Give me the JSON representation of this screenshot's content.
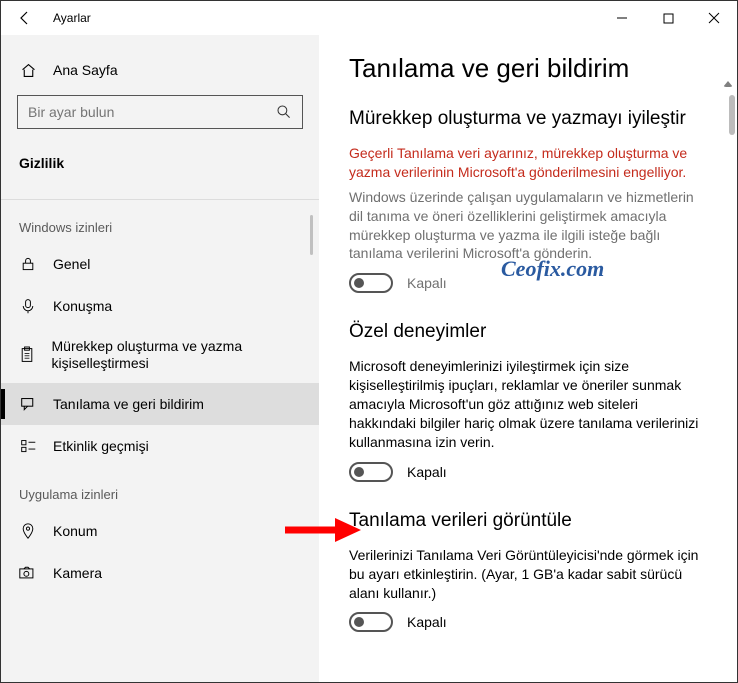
{
  "titlebar": {
    "app": "Ayarlar"
  },
  "sidebar": {
    "home": "Ana Sayfa",
    "search_placeholder": "Bir ayar bulun",
    "section": "Gizlilik",
    "group1": "Windows izinleri",
    "items1": [
      {
        "label": "Genel"
      },
      {
        "label": "Konuşma"
      },
      {
        "label": "Mürekkep oluşturma ve yazma kişiselleştirmesi"
      },
      {
        "label": "Tanılama ve geri bildirim"
      },
      {
        "label": "Etkinlik geçmişi"
      }
    ],
    "group2": "Uygulama izinleri",
    "items2": [
      {
        "label": "Konum"
      },
      {
        "label": "Kamera"
      }
    ]
  },
  "main": {
    "title": "Tanılama ve geri bildirim",
    "sec1": {
      "heading": "Mürekkep oluşturma ve yazmayı iyileştir",
      "warn": "Geçerli Tanılama veri ayarınız, mürekkep oluşturma ve yazma verilerinin Microsoft'a gönderilmesini engelliyor.",
      "desc": "Windows üzerinde çalışan uygulamaların ve hizmetlerin dil tanıma ve öneri özelliklerini geliştirmek amacıyla mürekkep oluşturma ve yazma ile ilgili isteğe bağlı tanılama verilerini Microsoft'a gönderin.",
      "toggle_state": "Kapalı"
    },
    "sec2": {
      "heading": "Özel deneyimler",
      "desc": "Microsoft deneyimlerinizi iyileştirmek için size kişiselleştirilmiş ipuçları, reklamlar ve öneriler sunmak amacıyla Microsoft'un göz attığınız web siteleri hakkındaki bilgiler hariç olmak üzere tanılama verilerinizi kullanmasına izin verin.",
      "toggle_state": "Kapalı"
    },
    "sec3": {
      "heading": "Tanılama verileri görüntüle",
      "desc": "Verilerinizi Tanılama Veri Görüntüleyicisi'nde görmek için bu ayarı etkinleştirin. (Ayar, 1 GB'a kadar sabit sürücü alanı kullanır.)",
      "toggle_state": "Kapalı"
    }
  },
  "watermark": "Ceofix.com"
}
